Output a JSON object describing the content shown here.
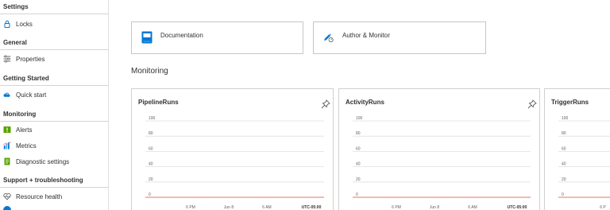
{
  "sidebar": {
    "settings": {
      "header": "Settings",
      "items": [
        {
          "label": "Locks",
          "icon": "lock-icon"
        }
      ]
    },
    "general": {
      "header": "General",
      "items": [
        {
          "label": "Properties",
          "icon": "properties-icon"
        }
      ]
    },
    "getting_started": {
      "header": "Getting Started",
      "items": [
        {
          "label": "Quick start",
          "icon": "cloud-quickstart-icon"
        }
      ]
    },
    "monitoring": {
      "header": "Monitoring",
      "items": [
        {
          "label": "Alerts",
          "icon": "alerts-icon"
        },
        {
          "label": "Metrics",
          "icon": "metrics-icon"
        },
        {
          "label": "Diagnostic settings",
          "icon": "diagnostic-settings-icon"
        }
      ]
    },
    "support": {
      "header": "Support + troubleshooting",
      "items": [
        {
          "label": "Resource health",
          "icon": "heart-icon"
        }
      ]
    }
  },
  "tiles": {
    "documentation": {
      "label": "Documentation",
      "icon": "book-icon"
    },
    "author_monitor": {
      "label": "Author & Monitor",
      "icon": "author-monitor-icon"
    }
  },
  "main": {
    "section_title": "Monitoring"
  },
  "colors": {
    "accent": "#0078d4",
    "series_line": "#e8706b",
    "grid": "#e1dfdd"
  },
  "chart_data": [
    {
      "type": "line",
      "title": "PipelineRuns",
      "y_ticks": [
        "100",
        "80",
        "60",
        "40",
        "20",
        "0"
      ],
      "x_ticks": [
        "6 PM",
        "Jun 8",
        "6 AM",
        "UTC-05:00"
      ],
      "ylim": [
        0,
        100
      ],
      "series": [
        {
          "values": [
            0,
            0,
            0,
            0,
            0
          ]
        }
      ]
    },
    {
      "type": "line",
      "title": "ActivityRuns",
      "y_ticks": [
        "100",
        "80",
        "60",
        "40",
        "20",
        "0"
      ],
      "x_ticks": [
        "6 PM",
        "Jun 8",
        "6 AM",
        "UTC-05:00"
      ],
      "ylim": [
        0,
        100
      ],
      "series": [
        {
          "values": [
            0,
            0,
            0,
            0,
            0
          ]
        }
      ]
    },
    {
      "type": "line",
      "title": "TriggerRuns",
      "y_ticks": [
        "100",
        "80",
        "60",
        "40",
        "20",
        "0"
      ],
      "x_ticks": [
        "6 P"
      ],
      "ylim": [
        0,
        100
      ],
      "series": [
        {
          "values": [
            0,
            0,
            0,
            0,
            0
          ]
        }
      ]
    }
  ]
}
